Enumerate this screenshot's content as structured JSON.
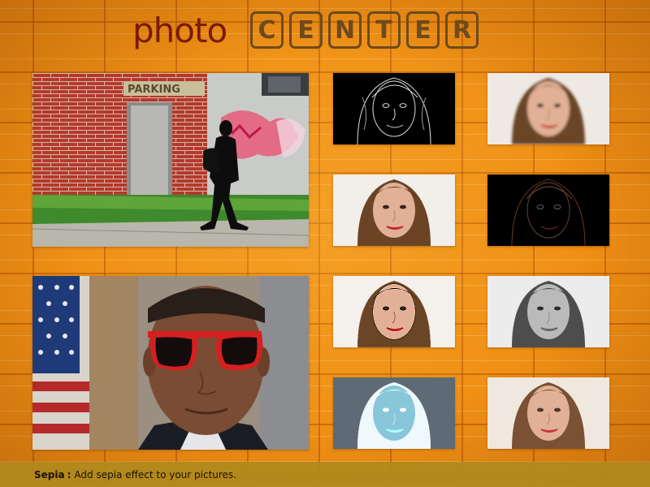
{
  "app": {
    "logo_prefix": "photo",
    "logo_letters": [
      "C",
      "E",
      "N",
      "T",
      "E",
      "R"
    ]
  },
  "colors": {
    "background": "#ef8f14",
    "logo_prefix": "#7a1a08",
    "logo_boxes": "#6e4a1c",
    "status_bar": "#b08a1c"
  },
  "tiles": {
    "main_1": {
      "subject": "man walking past brick wall with PARKING sign and graffiti",
      "sign_text": "PARKING"
    },
    "main_2": {
      "subject": "portrait with red sunglasses and flag background"
    },
    "small": [
      {
        "effect": "edge detect (white on black)"
      },
      {
        "effect": "blur"
      },
      {
        "effect": "original"
      },
      {
        "effect": "edge detect (colored on black)"
      },
      {
        "effect": "sharpen"
      },
      {
        "effect": "grayscale"
      },
      {
        "effect": "invert"
      },
      {
        "effect": "sepia / warm"
      }
    ]
  },
  "status": {
    "effect_name": "Sepia",
    "separator": ":",
    "description": "Add sepia effect to your pictures."
  }
}
